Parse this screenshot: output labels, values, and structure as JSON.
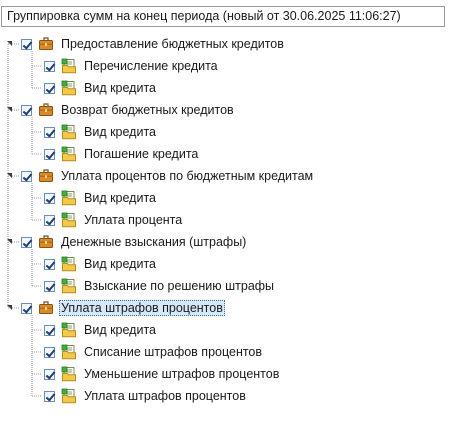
{
  "dropdown": {
    "value": "Группировка сумм на конец периода (новый от 30.06.2025 11:06:27)"
  },
  "tree": {
    "groups": [
      {
        "label": "Предоставление бюджетных кредитов",
        "icon": "briefcase-icon",
        "checked": true,
        "children": [
          {
            "label": "Перечисление кредита",
            "icon": "document-folder-icon",
            "checked": true
          },
          {
            "label": "Вид кредита",
            "icon": "document-folder-icon",
            "checked": true
          }
        ]
      },
      {
        "label": "Возврат бюджетных кредитов",
        "icon": "briefcase-icon",
        "checked": true,
        "children": [
          {
            "label": "Вид кредита",
            "icon": "document-folder-icon",
            "checked": true
          },
          {
            "label": "Погашение кредита",
            "icon": "document-folder-icon",
            "checked": true
          }
        ]
      },
      {
        "label": "Уплата процентов по бюджетным кредитам",
        "icon": "briefcase-icon",
        "checked": true,
        "children": [
          {
            "label": "Вид кредита",
            "icon": "document-folder-icon",
            "checked": true
          },
          {
            "label": "Уплата процента",
            "icon": "document-folder-icon",
            "checked": true
          }
        ]
      },
      {
        "label": "Денежные взыскания (штрафы)",
        "icon": "briefcase-icon",
        "checked": true,
        "children": [
          {
            "label": "Вид кредита",
            "icon": "document-folder-icon",
            "checked": true
          },
          {
            "label": "Взыскание по решению штрафы",
            "icon": "document-folder-icon",
            "checked": true
          }
        ]
      },
      {
        "label": "Уплата штрафов процентов",
        "icon": "briefcase-icon",
        "checked": true,
        "selected": true,
        "children": [
          {
            "label": "Вид кредита",
            "icon": "document-folder-icon",
            "checked": true
          },
          {
            "label": "Списание штрафов процентов",
            "icon": "document-folder-icon",
            "checked": true
          },
          {
            "label": "Уменьшение штрафов процентов",
            "icon": "document-folder-icon",
            "checked": true
          },
          {
            "label": "Уплата штрафов процентов",
            "icon": "document-folder-icon",
            "checked": true
          }
        ]
      }
    ]
  }
}
